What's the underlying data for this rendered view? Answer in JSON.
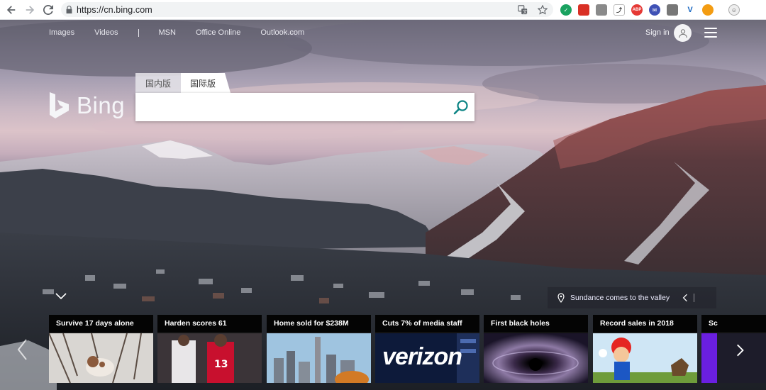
{
  "browser": {
    "url": "https://cn.bing.com",
    "extension_icons": [
      "extension-green-icon",
      "extension-red-icon",
      "extension-gray-icon",
      "extension-chart-icon",
      "extension-abp-icon",
      "extension-mail-icon",
      "extension-doc-icon",
      "extension-v-icon",
      "extension-orange-icon",
      "extension-face-icon"
    ]
  },
  "topnav": {
    "links": [
      "Images",
      "Videos",
      "MSN",
      "Office Online",
      "Outlook.com"
    ],
    "signin": "Sign in"
  },
  "logo": {
    "text": "Bing"
  },
  "search": {
    "tabs": [
      "国内版",
      "国际版"
    ],
    "active_tab": 1,
    "value": ""
  },
  "caption": {
    "text": "Sundance comes to the valley"
  },
  "carousel": {
    "cards": [
      {
        "title": "Survive 17 days alone"
      },
      {
        "title": "Harden scores 61"
      },
      {
        "title": "Home sold for $238M"
      },
      {
        "title": "Cuts 7% of media staff"
      },
      {
        "title": "First black holes"
      },
      {
        "title": "Record sales in 2018"
      },
      {
        "title": "Sc"
      }
    ]
  },
  "colors": {
    "search_accent": "#0c8484",
    "verizon_text": "#ffffff"
  },
  "card_texts": {
    "verizon": "verizon"
  }
}
